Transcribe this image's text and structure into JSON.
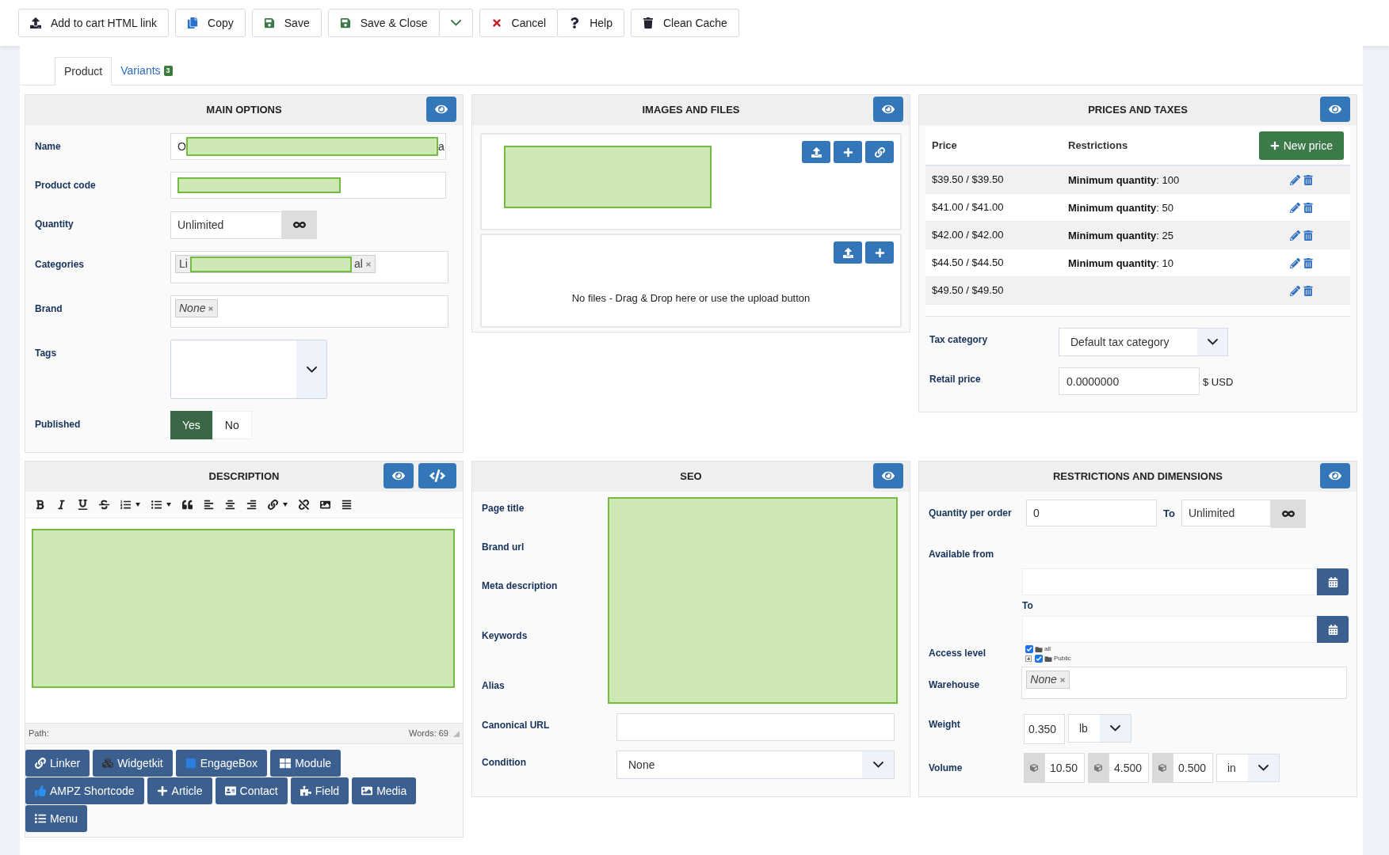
{
  "toolbar": [
    {
      "label": "Add to cart HTML link"
    },
    {
      "label": "Copy"
    },
    {
      "label": "Save"
    },
    {
      "label": "Save & Close",
      "split": true
    },
    {
      "label": "Cancel"
    },
    {
      "label": "Help"
    },
    {
      "label": "Clean Cache"
    }
  ],
  "tabs": [
    {
      "label": "Product",
      "selected": true
    },
    {
      "label": "Variants",
      "selected": false,
      "badge": "3"
    }
  ],
  "main_options": {
    "title": "MAIN OPTIONS",
    "fields": [
      {
        "kind": "redacted_text",
        "label": "Name",
        "parts": [
          "O",
          "a"
        ]
      },
      {
        "kind": "redacted",
        "label": "Product code"
      },
      {
        "kind": "unlimited",
        "label": "Quantity",
        "value": "Unlimited"
      },
      {
        "kind": "redacted_tag",
        "label": "Categories",
        "parts": [
          "Li",
          "al"
        ]
      },
      {
        "kind": "tags",
        "label": "Brand",
        "tags": [
          "None"
        ]
      },
      {
        "kind": "multiselect",
        "label": "Tags"
      },
      {
        "kind": "toggle",
        "label": "Published",
        "options": [
          {
            "label": "Yes",
            "selected": true
          },
          {
            "label": "No",
            "selected": false
          }
        ]
      }
    ]
  },
  "images_and_files": {
    "title": "IMAGES AND FILES",
    "files_message": "No files - Drag & Drop here or use the upload button"
  },
  "prices_and_taxes": {
    "title": "PRICES AND TAXES",
    "columns": [
      "Price",
      "Restrictions"
    ],
    "new_price": "New price",
    "rows": [
      {
        "price": "$39.50 / $39.50",
        "restriction": "**Minimum quantity**: 100"
      },
      {
        "price": "$41.00 / $41.00",
        "restriction": "**Minimum quantity**: 50"
      },
      {
        "price": "$42.00 / $42.00",
        "restriction": "**Minimum quantity**: 25"
      },
      {
        "price": "$44.50 / $44.50",
        "restriction": "**Minimum quantity**: 10"
      },
      {
        "price": "$49.50 / $49.50"
      }
    ],
    "tax_category": {
      "label": "Tax category",
      "value": "Default tax category"
    },
    "retail_price": {
      "label": "Retail price",
      "value": "0.0000000",
      "unit": "$ USD"
    }
  },
  "description": {
    "title": "DESCRIPTION",
    "path": "Path:",
    "words": "Words: 69",
    "buttons": [
      "Linker",
      "Widgetkit",
      "EngageBox",
      "Module",
      "AMPZ Shortcode",
      "Article",
      "Contact",
      "Field",
      "Media",
      "Menu"
    ]
  },
  "seo": {
    "title": "SEO",
    "labels": [
      "Page title",
      "Brand url",
      "Meta description",
      "Keywords",
      "Alias"
    ],
    "canonical_url": {
      "label": "Canonical URL"
    },
    "condition": {
      "label": "Condition",
      "value": "None"
    }
  },
  "restrictions": {
    "title": "RESTRICTIONS AND DIMENSIONS",
    "quantity": {
      "label": "Quantity per order",
      "min": "0",
      "to": "To",
      "max": "Unlimited"
    },
    "available": {
      "label": "Available from",
      "to": "To"
    },
    "access": {
      "label": "Access level",
      "items": [
        {
          "label": "all",
          "checked": true,
          "children": [
            {
              "label": "Public",
              "checked": true
            }
          ]
        }
      ]
    },
    "warehouse": {
      "label": "Warehouse",
      "tags": [
        "None"
      ]
    },
    "weight": {
      "label": "Weight",
      "value": "0.350",
      "unit": "lb"
    },
    "volume": {
      "label": "Volume",
      "values": [
        "10.50",
        "4.500",
        "0.500"
      ],
      "unit": "in"
    }
  }
}
